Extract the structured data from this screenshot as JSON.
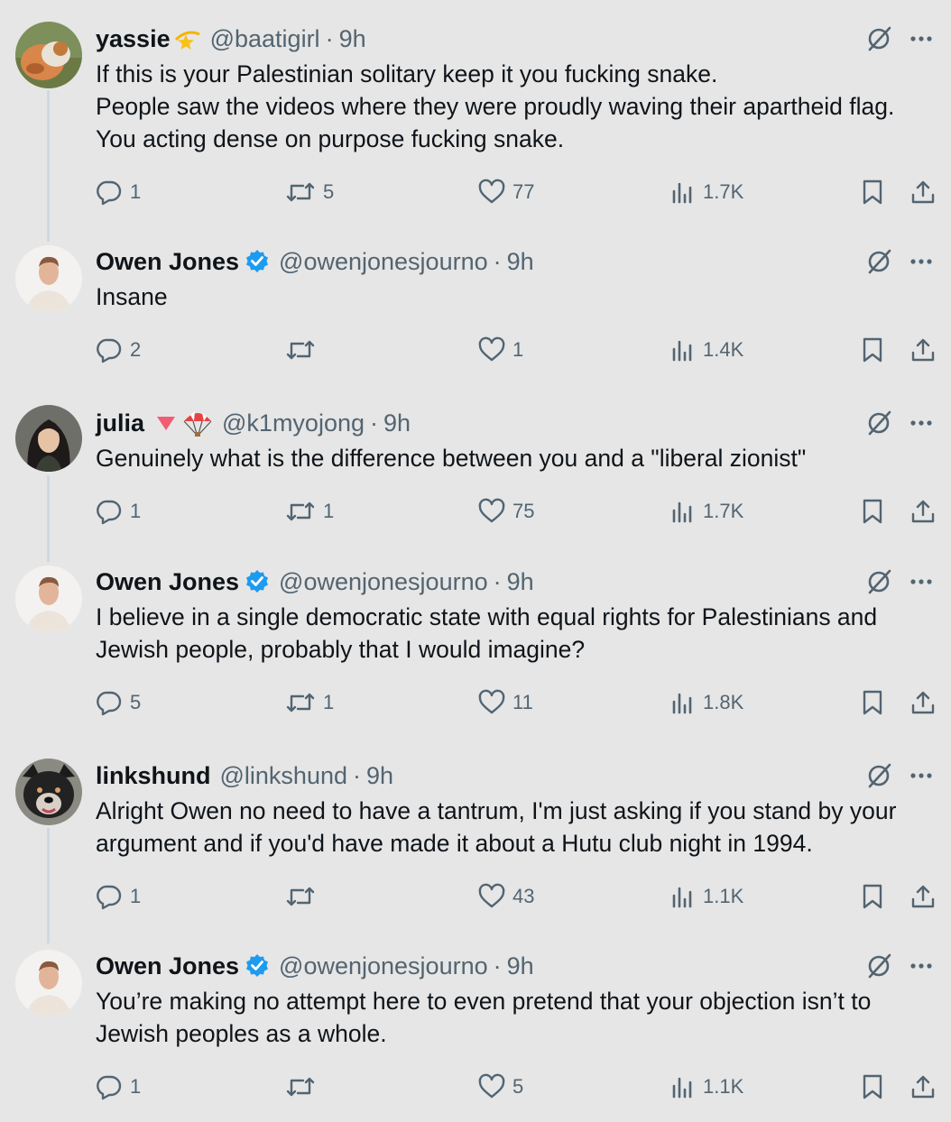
{
  "tweets": [
    {
      "name": "yassie",
      "emoji": "💫",
      "handle": "@baatigirl",
      "time": "9h",
      "lines": [
        "If this is your Palestinian solitary keep it you fucking snake.",
        "People saw the videos where they were proudly waving their apartheid flag.",
        "You acting dense on purpose fucking snake."
      ],
      "replies": "1",
      "reposts": "5",
      "likes": "77",
      "views": "1.7K"
    },
    {
      "name": "Owen Jones",
      "verified": true,
      "handle": "@owenjonesjourno",
      "time": "9h",
      "lines": [
        "Insane"
      ],
      "replies": "2",
      "reposts": "",
      "likes": "1",
      "views": "1.4K"
    },
    {
      "name": "julia",
      "emoji": "🔻🪂",
      "handle": "@k1myojong",
      "time": "9h",
      "lines": [
        "Genuinely what is the difference between you and a \"liberal zionist\""
      ],
      "replies": "1",
      "reposts": "1",
      "likes": "75",
      "views": "1.7K"
    },
    {
      "name": "Owen Jones",
      "verified": true,
      "handle": "@owenjonesjourno",
      "time": "9h",
      "lines": [
        "I believe in a single democratic state with equal rights for Palestinians and",
        "Jewish people, probably that I would imagine?"
      ],
      "replies": "5",
      "reposts": "1",
      "likes": "11",
      "views": "1.8K"
    },
    {
      "name": "linkshund",
      "handle": "@linkshund",
      "time": "9h",
      "lines": [
        "Alright Owen no need to have a tantrum, I'm just asking if you stand by your",
        "argument and if you'd have made it about a Hutu club night in 1994."
      ],
      "replies": "1",
      "reposts": "",
      "likes": "43",
      "views": "1.1K"
    },
    {
      "name": "Owen Jones",
      "verified": true,
      "handle": "@owenjonesjourno",
      "time": "9h",
      "lines": [
        "You’re making no attempt here to even pretend that your objection isn’t to",
        "Jewish peoples as a whole."
      ],
      "replies": "1",
      "reposts": "",
      "likes": "5",
      "views": "1.1K"
    }
  ],
  "separator": "·",
  "colors": {
    "background": "#e6e6e6",
    "text": "#0f1419",
    "secondary": "#536471",
    "verified": "#1d9bf0",
    "thread_line": "#cfd9de"
  },
  "icons": {
    "reply": "reply-icon",
    "repost": "repost-icon",
    "like": "heart-icon",
    "views": "views-icon",
    "bookmark": "bookmark-icon",
    "share": "share-icon",
    "grok": "grok-icon",
    "more": "more-icon"
  }
}
